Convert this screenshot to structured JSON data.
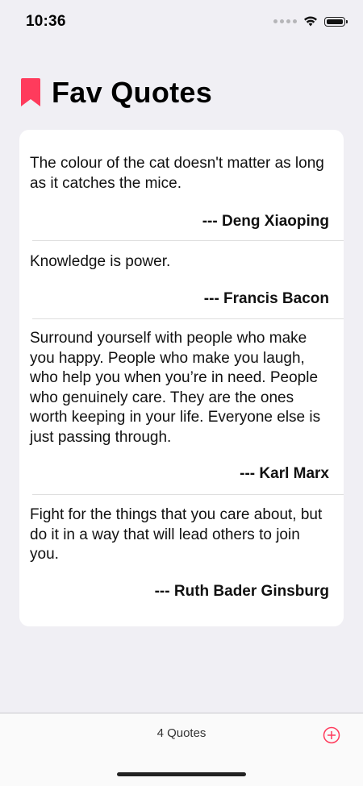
{
  "status_bar": {
    "time": "10:36"
  },
  "header": {
    "title": "Fav Quotes",
    "icon": "bookmark-icon"
  },
  "quotes": [
    {
      "text": "The colour of the cat doesn't matter as long as it catches the mice.",
      "author": "--- Deng Xiaoping"
    },
    {
      "text": "Knowledge is power.",
      "author": "--- Francis Bacon"
    },
    {
      "text": "Surround yourself with people who make you happy. People who make you laugh, who help you when you’re in need. People who genuinely care. They are the ones worth keeping in your life. Everyone else is just passing through.",
      "author": "--- Karl Marx"
    },
    {
      "text": "Fight for the things that you care about, but do it in a way that will lead others to join you.",
      "author": "--- Ruth Bader Ginsburg"
    }
  ],
  "toolbar": {
    "count_label": "4 Quotes",
    "add_icon": "add-circle-icon"
  },
  "colors": {
    "accent": "#ff3b5c",
    "background": "#f0eff4",
    "card": "#ffffff"
  }
}
